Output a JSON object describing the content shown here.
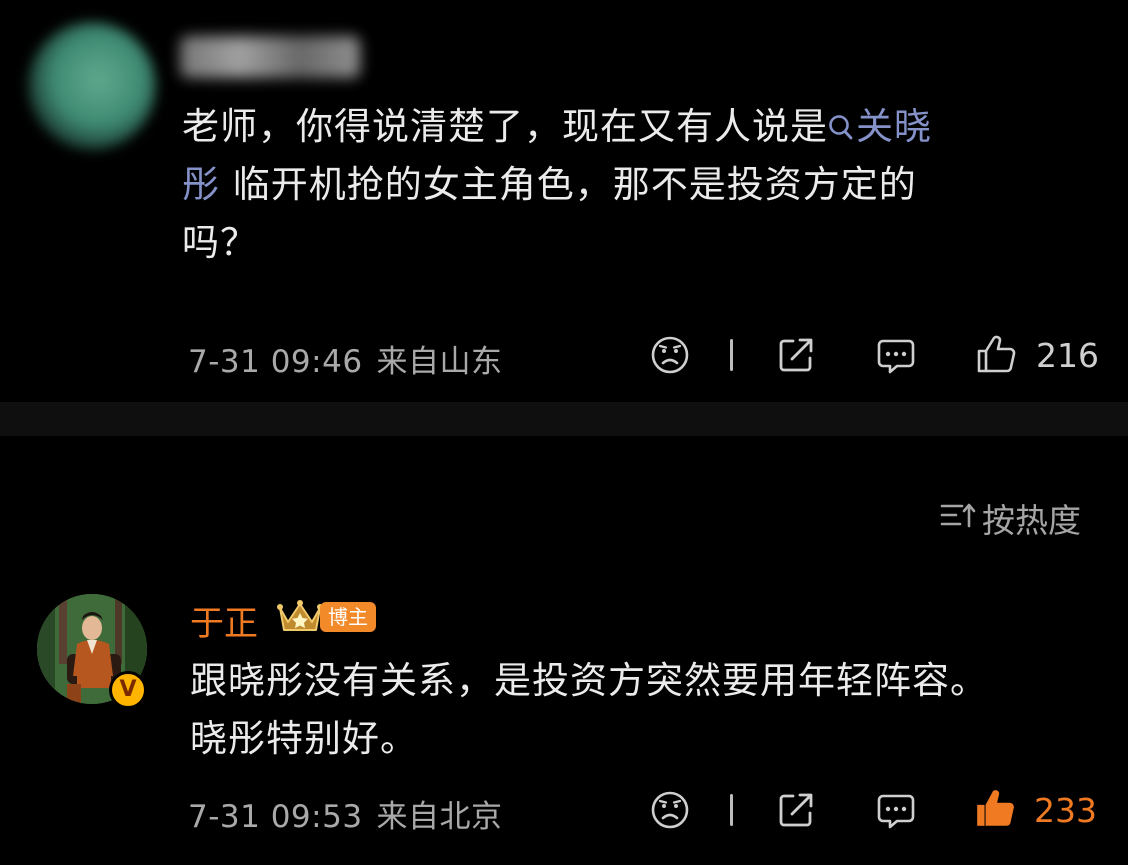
{
  "comment1": {
    "line1": "老师，你得说清楚了，现在又有人说是",
    "topic_a": "关晓",
    "topic_b": "彤",
    "line2_rest": " 临开机抢的女主角色，那不是投资方定的",
    "line3": "吗？",
    "time": "7-31 09:46",
    "location": "来自山东",
    "likes": "216"
  },
  "sort": {
    "label": "按热度"
  },
  "reply": {
    "name": "于正",
    "badge": "博主",
    "verified": "V",
    "line1": "跟晓彤没有关系，是投资方突然要用年轻阵容。",
    "line2": "晓彤特别好。",
    "time": "7-31 09:53",
    "location": "来自北京",
    "likes": "233"
  },
  "colors": {
    "accent": "#f07a22",
    "topic": "#8592c9",
    "background": "#000000"
  },
  "icons": [
    "search-icon",
    "sad-face-icon",
    "share-icon",
    "comment-icon",
    "thumbs-up-icon",
    "sort-icon",
    "crown-icon"
  ]
}
